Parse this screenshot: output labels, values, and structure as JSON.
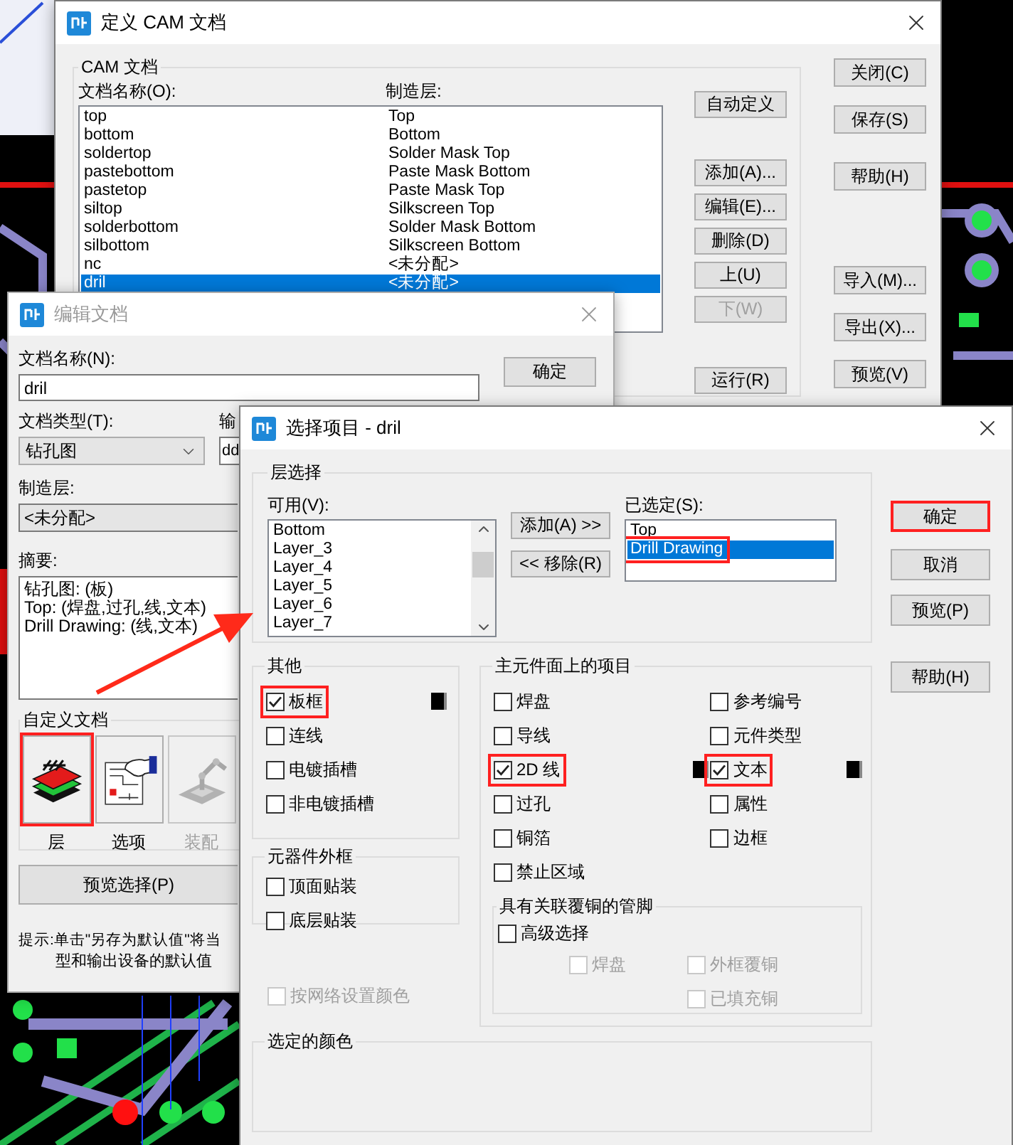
{
  "cam_window": {
    "title": "定义 CAM 文档",
    "active": true,
    "group_label": "CAM 文档",
    "name_header": "文档名称(O):",
    "layer_header": "制造层:",
    "files": [
      {
        "name": "top",
        "layer": "Top",
        "selected": false
      },
      {
        "name": "bottom",
        "layer": "Bottom",
        "selected": false
      },
      {
        "name": "soldertop",
        "layer": "Solder Mask Top",
        "selected": false
      },
      {
        "name": "pastebottom",
        "layer": "Paste Mask Bottom",
        "selected": false
      },
      {
        "name": "pastetop",
        "layer": "Paste Mask Top",
        "selected": false
      },
      {
        "name": "siltop",
        "layer": "Silkscreen Top",
        "selected": false
      },
      {
        "name": "solderbottom",
        "layer": "Solder Mask Bottom",
        "selected": false
      },
      {
        "name": "silbottom",
        "layer": "Silkscreen Bottom",
        "selected": false
      },
      {
        "name": "nc",
        "layer": "<未分配>",
        "selected": false
      },
      {
        "name": "dril",
        "layer": "<未分配>",
        "selected": true
      }
    ],
    "action_buttons": [
      {
        "label": "自动定义",
        "disabled": false
      },
      {
        "label": "添加(A)...",
        "disabled": false
      },
      {
        "label": "编辑(E)...",
        "disabled": false
      },
      {
        "label": "删除(D)",
        "disabled": false
      },
      {
        "label": "上(U)",
        "disabled": false
      },
      {
        "label": "下(W)",
        "disabled": true
      },
      {
        "label": "运行(R)",
        "disabled": false
      }
    ],
    "side_buttons": [
      "关闭(C)",
      "保存(S)",
      "帮助(H)",
      "导入(M)...",
      "导出(X)...",
      "预览(V)"
    ]
  },
  "edit_window": {
    "title": "编辑文档",
    "active": false,
    "name_label": "文档名称(N):",
    "name_value": "dril",
    "ok_button": "确定",
    "type_label": "文档类型(T):",
    "type_value": "钻孔图",
    "output_label": "输",
    "output_value": "dd",
    "layer_label": "制造层:",
    "layer_value": "<未分配>",
    "summary_label": "摘要:",
    "summary_lines": [
      "钻孔图: (板)",
      "Top: (焊盘,过孔,线,文本)",
      "Drill Drawing: (线,文本)"
    ],
    "custom_label": "自定义文档",
    "custom_items": [
      {
        "kind": "layers",
        "label": "层",
        "disabled": false,
        "highlight": true
      },
      {
        "kind": "options",
        "label": "选项",
        "disabled": false,
        "highlight": false
      },
      {
        "kind": "assembly",
        "label": "装配",
        "disabled": true,
        "highlight": false
      }
    ],
    "preview_button": "预览选择(P)",
    "hint_lines": [
      "提示:单击\"另存为默认值\"将当",
      "型和输出设备的默认值"
    ]
  },
  "select_window": {
    "title": "选择项目 - dril",
    "active": true,
    "layer_group": {
      "label": "层选择",
      "available_label": "可用(V):",
      "available": [
        "Bottom",
        "Layer_3",
        "Layer_4",
        "Layer_5",
        "Layer_6",
        "Layer_7"
      ],
      "add_button": "添加(A) >>",
      "remove_button": "<< 移除(R)",
      "selected_label": "已选定(S):",
      "selected_layers": [
        {
          "label": "Top",
          "selected": false,
          "highlight": false
        },
        {
          "label": "Drill Drawing",
          "selected": true,
          "highlight": true
        }
      ]
    },
    "buttons": [
      {
        "label": "确定",
        "highlight": true
      },
      {
        "label": "取消",
        "highlight": false
      },
      {
        "label": "预览(P)",
        "highlight": false
      },
      {
        "label": "帮助(H)",
        "highlight": false
      }
    ],
    "other_group": {
      "label": "其他",
      "items": [
        {
          "label": "板框",
          "checked": true,
          "disabled": false,
          "highlight": true,
          "color": "#000000"
        },
        {
          "label": "连线",
          "checked": false,
          "disabled": false,
          "highlight": false
        },
        {
          "label": "电镀插槽",
          "checked": false,
          "disabled": false,
          "highlight": false
        },
        {
          "label": "非电镀插槽",
          "checked": false,
          "disabled": false,
          "highlight": false
        }
      ]
    },
    "outline_group": {
      "label": "元器件外框",
      "items": [
        {
          "label": "顶面贴装",
          "checked": false,
          "disabled": false,
          "highlight": false
        },
        {
          "label": "底层贴装",
          "checked": false,
          "disabled": false,
          "highlight": false
        }
      ]
    },
    "net_color": {
      "label": "按网络设置颜色",
      "checked": false,
      "disabled": true,
      "highlight": false
    },
    "primary_group": {
      "label": "主元件面上的项目",
      "columns": [
        [
          {
            "label": "焊盘",
            "checked": false,
            "disabled": false,
            "highlight": false
          },
          {
            "label": "导线",
            "checked": false,
            "disabled": false,
            "highlight": false
          },
          {
            "label": "2D 线",
            "checked": true,
            "disabled": false,
            "highlight": true,
            "color": "#000000"
          },
          {
            "label": "过孔",
            "checked": false,
            "disabled": false,
            "highlight": false
          },
          {
            "label": "铜箔",
            "checked": false,
            "disabled": false,
            "highlight": false
          },
          {
            "label": "禁止区域",
            "checked": false,
            "disabled": false,
            "highlight": false
          }
        ],
        [
          {
            "label": "参考编号",
            "checked": false,
            "disabled": false,
            "highlight": false
          },
          {
            "label": "元件类型",
            "checked": false,
            "disabled": false,
            "highlight": false
          },
          {
            "label": "文本",
            "checked": true,
            "disabled": false,
            "highlight": true,
            "color": "#000000"
          },
          {
            "label": "属性",
            "checked": false,
            "disabled": false,
            "highlight": false
          },
          {
            "label": "边框",
            "checked": false,
            "disabled": false,
            "highlight": false
          }
        ]
      ],
      "pin_group": {
        "label": "具有关联覆铜的管脚",
        "advanced": {
          "label": "高级选择",
          "checked": false,
          "disabled": false,
          "highlight": false
        },
        "options": [
          {
            "label": "焊盘",
            "checked": false,
            "disabled": true,
            "highlight": false
          },
          {
            "label": "外框覆铜",
            "checked": false,
            "disabled": true,
            "highlight": false
          },
          {
            "label": "已填充铜",
            "checked": false,
            "disabled": true,
            "highlight": false
          }
        ]
      }
    },
    "color_group": {
      "label": "选定的颜色"
    }
  }
}
